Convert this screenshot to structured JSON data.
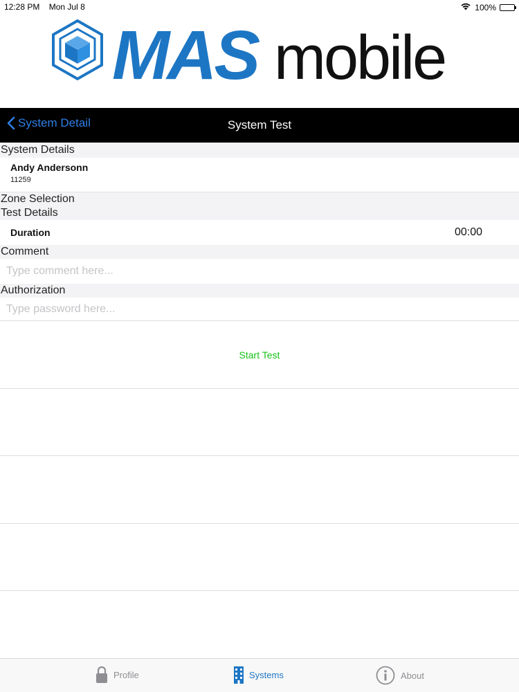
{
  "status_bar": {
    "time": "12:28 PM",
    "date": "Mon Jul 8",
    "battery": "100%"
  },
  "logo": {
    "mas": "MAS",
    "mobile": "mobile"
  },
  "nav": {
    "back_label": "System Detail",
    "title": "System Test"
  },
  "sections": {
    "system_details": "System Details",
    "zone_selection": "Zone Selection",
    "test_details": "Test Details",
    "comment": "Comment",
    "authorization": "Authorization"
  },
  "system": {
    "name": "Andy Andersonn",
    "account": "11259"
  },
  "test": {
    "duration_label": "Duration",
    "duration_value": "00:00"
  },
  "comment": {
    "placeholder": "Type comment here...",
    "value": ""
  },
  "authorization": {
    "placeholder": "Type password here...",
    "value": ""
  },
  "start_button": "Start Test",
  "tabs": [
    {
      "label": "Profile",
      "icon": "lock-icon"
    },
    {
      "label": "Systems",
      "icon": "building-icon",
      "active": true
    },
    {
      "label": "About",
      "icon": "info-icon"
    }
  ],
  "colors": {
    "accent": "#1d76c4",
    "start": "#16c216",
    "nav_link": "#2f7fe6"
  }
}
